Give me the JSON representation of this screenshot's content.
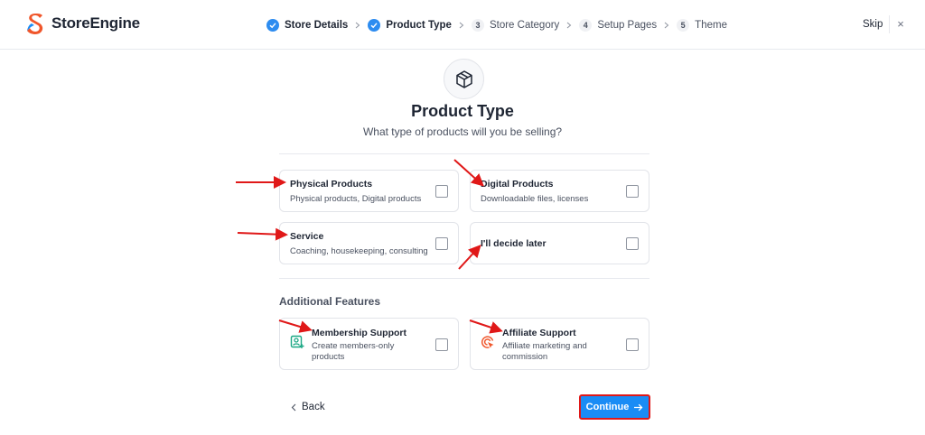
{
  "app": {
    "brand": "StoreEngine"
  },
  "stepper": {
    "steps": [
      {
        "label": "Store Details",
        "status": "done"
      },
      {
        "label": "Product Type",
        "status": "done"
      },
      {
        "number": "3",
        "label": "Store Category",
        "status": "pending"
      },
      {
        "number": "4",
        "label": "Setup Pages",
        "status": "pending"
      },
      {
        "number": "5",
        "label": "Theme",
        "status": "pending"
      }
    ]
  },
  "header": {
    "skip_label": "Skip",
    "close_label": "×"
  },
  "main": {
    "icon": "box-icon",
    "title": "Product Type",
    "subtitle": "What type of products will you be selling?"
  },
  "options": [
    {
      "title": "Physical Products",
      "desc": "Physical products, Digital products",
      "checked": false
    },
    {
      "title": "Digital Products",
      "desc": "Downloadable files, licenses",
      "checked": false
    },
    {
      "title": "Service",
      "desc": "Coaching, housekeeping, consulting",
      "checked": false
    },
    {
      "title": "I'll decide later",
      "checked": false
    }
  ],
  "additional": {
    "heading": "Additional Features",
    "features": [
      {
        "icon": "member-icon",
        "title": "Membership Support",
        "desc": "Create members-only products",
        "checked": false
      },
      {
        "icon": "target-icon",
        "title": "Affiliate Support",
        "desc": "Affiliate marketing and commission",
        "checked": false
      }
    ]
  },
  "footer": {
    "back_label": "Back",
    "continue_label": "Continue"
  },
  "colors": {
    "accent": "#1a8cf5",
    "step_done": "#2d8cf0",
    "annotation": "#e01818",
    "membership_icon": "#1ba784",
    "affiliate_icon": "#f0562b"
  }
}
